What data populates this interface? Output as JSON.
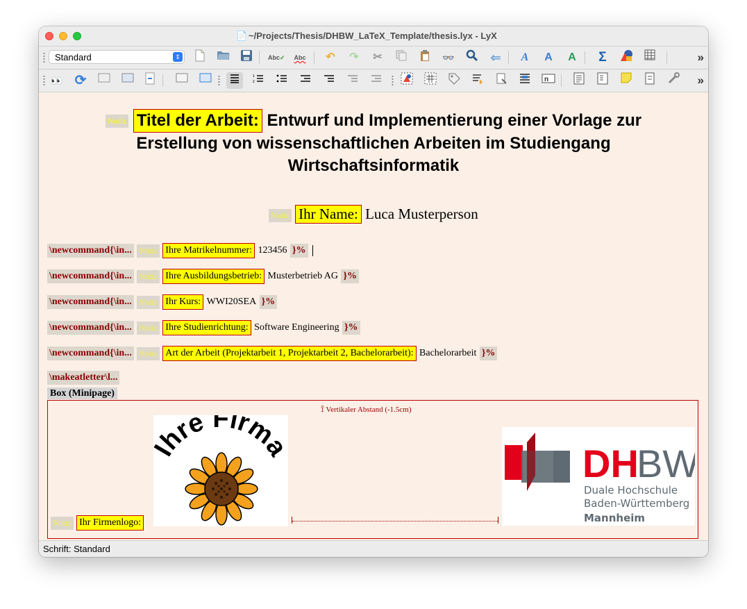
{
  "window": {
    "title": "~/Projects/Thesis/DHBW_LaTeX_Template/thesis.lyx - LyX"
  },
  "toolbar1": {
    "style_select": "Standard",
    "icons": [
      "new-document-icon",
      "open-icon",
      "save-icon",
      "spellcheck-icon",
      "spellcheck-continuous-icon",
      "undo-icon",
      "redo-icon",
      "cut-icon",
      "copy-icon",
      "paste-icon",
      "find-icon",
      "find-replace-icon",
      "back-icon",
      "font-emphasis-icon",
      "text-style-icon",
      "noun-icon",
      "math-sum-icon",
      "insert-graphics-icon",
      "insert-table-icon"
    ],
    "overflow": "»",
    "glyph_undo": "↶",
    "glyph_redo": "↷",
    "glyph_cut": "✂",
    "glyph_sum": "Σ",
    "glyph_search": "🔍",
    "glyph_back": "⇐"
  },
  "toolbar2": {
    "overflow": "»",
    "glyph_view": "👀",
    "glyph_refresh": "⟳"
  },
  "document": {
    "title_notiz": "Notiz",
    "title_label": "Titel der Arbeit:",
    "title_text": "Entwurf und Implementierung einer Vorlage zur Erstellung von wissenschaftlichen Arbeiten im Studiengang Wirtschaftsinformatik",
    "name_notiz": "Notiz",
    "name_label": "Ihr Name:",
    "name_value": "Luca Musterperson",
    "fields": [
      {
        "cmd": "\\newcommand{\\in...",
        "notiz": "Notiz",
        "label": "Ihre Matrikelnummer:",
        "value": "123456",
        "end": "}%"
      },
      {
        "cmd": "\\newcommand{\\in...",
        "notiz": "Notiz",
        "label": "Ihre Ausbildungsbetrieb:",
        "value": "Musterbetrieb AG",
        "end": "}%"
      },
      {
        "cmd": "\\newcommand{\\in...",
        "notiz": "Notiz",
        "label": "Ihr Kurs:",
        "value": "WWI20SEA",
        "end": "}%"
      },
      {
        "cmd": "\\newcommand{\\in...",
        "notiz": "Notiz",
        "label": "Ihre Studienrichtung:",
        "value": "Software Engineering",
        "end": "}%"
      },
      {
        "cmd": "\\newcommand{\\in...",
        "notiz": "Notiz",
        "label": "Art der Arbeit (Projektarbeit 1, Projektarbeit 2, Bachelorarbeit):",
        "value": "Bachelorarbeit",
        "end": "}%"
      }
    ],
    "makeatletter": "\\makeatletter\\l...",
    "box_label": "Box (Minipage)",
    "vspace": "Vertikaler Abstand (-1.5cm)",
    "firma_logo_text": "Ihre Firma",
    "firmenlogo_notiz": "Notiz",
    "firmenlogo_label": "Ihr Firmenlogo:",
    "dhbw": {
      "line1": "DH",
      "line1b": "BW",
      "line2": "Duale Hochschule",
      "line3": "Baden-Württemberg",
      "line4": "Mannheim"
    }
  },
  "status": {
    "text": "Schrift: Standard"
  },
  "colors": {
    "highlight": "#ffff00",
    "border_red": "#c00000",
    "dhbw_red": "#e2001a",
    "dhbw_gray": "#5f6a72"
  }
}
